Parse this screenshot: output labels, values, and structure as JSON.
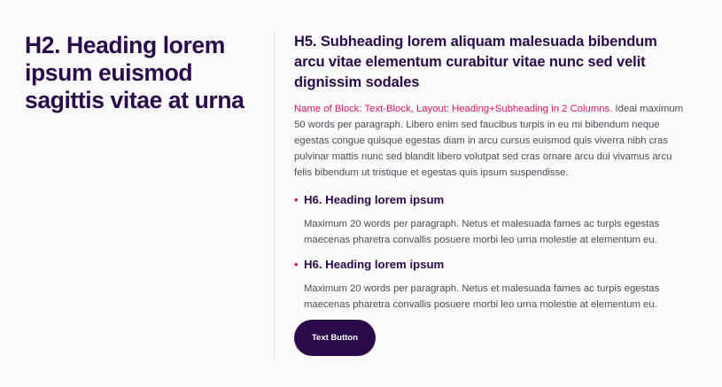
{
  "left": {
    "heading": "H2. Heading lorem ipsum euismod sagittis vitae at urna"
  },
  "right": {
    "subheading": "H5. Subheading lorem aliquam malesuada bibendum arcu vitae elementum curabitur vitae nunc sed velit dignissim sodales",
    "intro_accent": "Name of Block: Text-Block, Layout: Heading+Subheading in 2 Columns.",
    "intro_text": " Ideal maximum 50 words per paragraph. Libero enim sed faucibus turpis in eu mi bibendum neque egestas congue quisque egestas diam in arcu cursus euismod quis viverra nibh cras pulvinar mattis nunc sed blandit libero volutpat sed cras ornare arcu dui vivamus arcu felis bibendum ut tristique et egestas quis ipsum suspendisse.",
    "items": [
      {
        "bullet": "•",
        "heading": "H6. Heading lorem ipsum",
        "body": "Maximum 20 words per paragraph. Netus et malesuada fames ac turpis egestas maecenas pharetra convallis posuere morbi leo urna molestie at elementum eu."
      },
      {
        "bullet": "•",
        "heading": "H6. Heading lorem ipsum",
        "body": "Maximum 20 words per paragraph. Netus et malesuada fames ac turpis egestas maecenas pharetra convallis posuere morbi leo urna molestie at elementum eu."
      }
    ],
    "button_label": "Text Button"
  },
  "colors": {
    "background": "#fbfafa",
    "heading": "#2a0a4a",
    "accent": "#d1185e",
    "body_text": "#4e4a57",
    "button_bg": "#2a0a4a",
    "button_text": "#ffffff",
    "divider": "#e3e0e6"
  }
}
